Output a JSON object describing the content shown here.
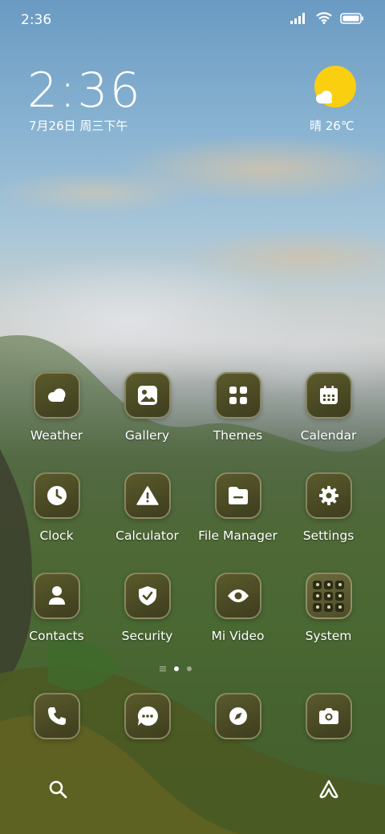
{
  "status_bar": {
    "time": "2:36",
    "icons": [
      "signal-icon",
      "wifi-icon",
      "battery-icon"
    ]
  },
  "clock_widget": {
    "time": "2:36",
    "date": "7月26日 周三下午"
  },
  "weather_widget": {
    "condition_icon": "partly-sunny-icon",
    "text": "晴 26℃"
  },
  "apps": [
    {
      "label": "Weather",
      "icon": "cloud-icon"
    },
    {
      "label": "Gallery",
      "icon": "image-icon"
    },
    {
      "label": "Themes",
      "icon": "grid-icon"
    },
    {
      "label": "Calendar",
      "icon": "calendar-icon"
    },
    {
      "label": "Clock",
      "icon": "clock-icon"
    },
    {
      "label": "Calculator",
      "icon": "warning-triangle-icon"
    },
    {
      "label": "File Manager",
      "icon": "folder-icon"
    },
    {
      "label": "Settings",
      "icon": "gear-icon"
    },
    {
      "label": "Contacts",
      "icon": "person-icon"
    },
    {
      "label": "Security",
      "icon": "shield-check-icon"
    },
    {
      "label": "Mi Video",
      "icon": "eye-icon"
    },
    {
      "label": "System",
      "icon": "folder-grid-icon"
    }
  ],
  "pager": {
    "pages": 2,
    "current": 1
  },
  "dock": [
    {
      "icon": "phone-icon"
    },
    {
      "icon": "message-icon"
    },
    {
      "icon": "compass-icon"
    },
    {
      "icon": "camera-icon"
    }
  ],
  "bottom_bar": {
    "left_icon": "search-icon",
    "right_icon": "assistant-icon"
  },
  "colors": {
    "icon_bg": "#4d4c26",
    "icon_glyph": "#ffffff",
    "sun": "#f9cf10"
  }
}
